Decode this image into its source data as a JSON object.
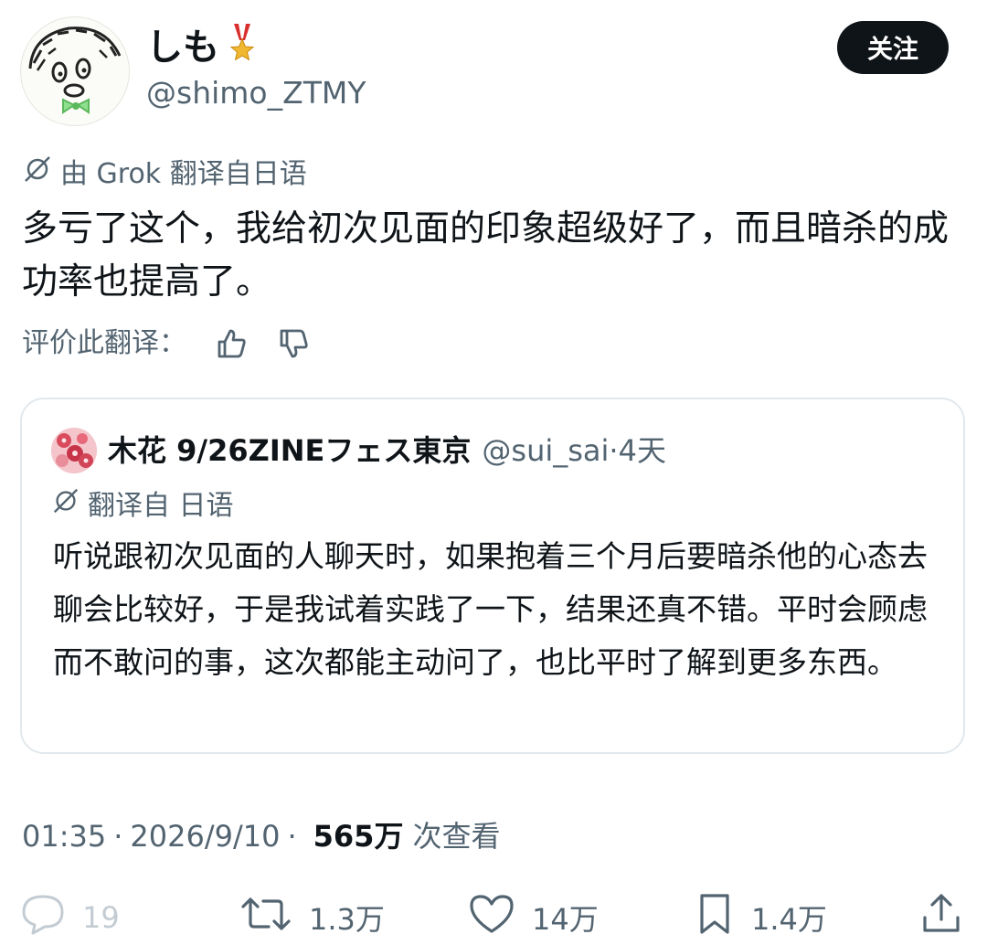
{
  "author": {
    "display_name": "しも",
    "badge_icon": "medal-icon",
    "handle": "@shimo_ZTMY"
  },
  "follow_label": "关注",
  "translation": {
    "label": "由 Grok 翻译自日语",
    "icon": "translate-icon"
  },
  "tweet_text": "多亏了这个，我给初次见面的印象超级好了，而且暗杀的成功率也提高了。",
  "rate": {
    "label": "评价此翻译："
  },
  "quote": {
    "name": "木花 9/26ZINEフェス東京",
    "handle": "@sui_sai",
    "dot": "·",
    "time": "4天",
    "translated_label": "翻译自 日语",
    "text": "听说跟初次见面的人聊天时，如果抱着三个月后要暗杀他的心态去聊会比较好，于是我试着实践了一下，结果还真不错。平时会顾虑而不敢问的事，这次都能主动问了，也比平时了解到更多东西。"
  },
  "meta": {
    "time": "01:35",
    "separator": "·",
    "date": "2026/9/10",
    "views_count": "565万",
    "views_label": "次查看"
  },
  "actions": {
    "reply_count": "19",
    "retweet_count": "1.3万",
    "like_count": "14万",
    "bookmark_count": "1.4万"
  },
  "colors": {
    "text_primary": "#0f1419",
    "text_secondary": "#536471",
    "border": "#e1e8ed",
    "follow_bg": "#0f1419"
  }
}
